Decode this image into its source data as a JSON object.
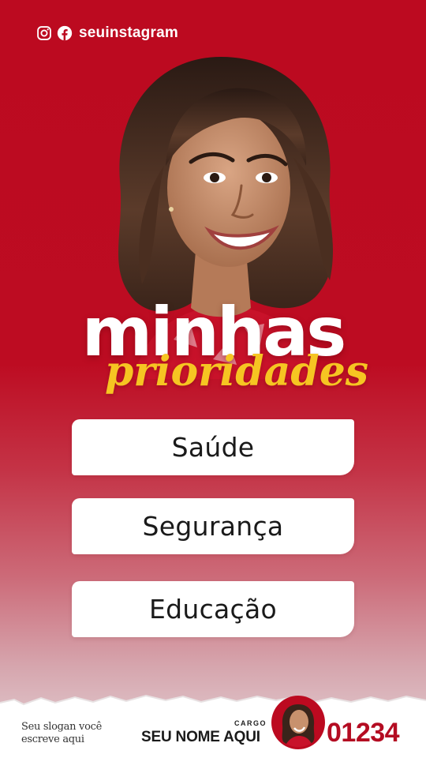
{
  "social": {
    "handle": "seuinstagram",
    "icons": [
      "instagram-icon",
      "facebook-icon"
    ]
  },
  "title": {
    "main": "minhas",
    "sub": "prioridades"
  },
  "priorities": [
    {
      "label": "Saúde"
    },
    {
      "label": "Segurança"
    },
    {
      "label": "Educação"
    }
  ],
  "footer": {
    "slogan": "Seu slogan você escreve aqui",
    "cargo": "CARGO",
    "name": "SEU NOME AQUI",
    "number": "01234"
  },
  "colors": {
    "brand_red": "#bc0a20",
    "accent_yellow": "#f6c522",
    "number_red": "#b40c22",
    "text_white": "#ffffff"
  }
}
